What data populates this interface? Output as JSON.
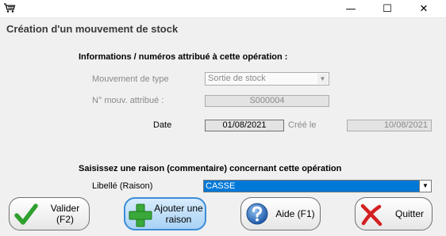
{
  "window": {
    "minimize": "—",
    "maximize": "☐",
    "close": "✕"
  },
  "form": {
    "title": "Création d'un mouvement de stock",
    "section_info": "Informations / numéros attribué à cette opération :",
    "type_label": "Mouvement de type",
    "type_value": "Sortie de stock",
    "num_label": "N° mouv. attribué :",
    "num_value": "S000004",
    "date_label": "Date",
    "date_value": "01/08/2021",
    "created_label": "Créé le",
    "created_value": "10/08/2021",
    "section_reason": "Saisissez une raison (commentaire) concernant cette opération",
    "reason_label": "Libellé (Raison)",
    "reason_value": "CASSE"
  },
  "buttons": {
    "validate": "Valider\n(F2)",
    "add_reason": "Ajouter une\nraison",
    "help": "Aide (F1)",
    "quit": "Quitter"
  },
  "icons": [
    "cart-icon",
    "checkmark-icon",
    "plus-icon",
    "help-icon",
    "cross-icon"
  ],
  "colors": {
    "selection": "#0078d7",
    "check_green": "#2ea02e",
    "plus_green": "#3aa83a",
    "help_blue": "#2f6fc0",
    "cross_red": "#d42020"
  }
}
